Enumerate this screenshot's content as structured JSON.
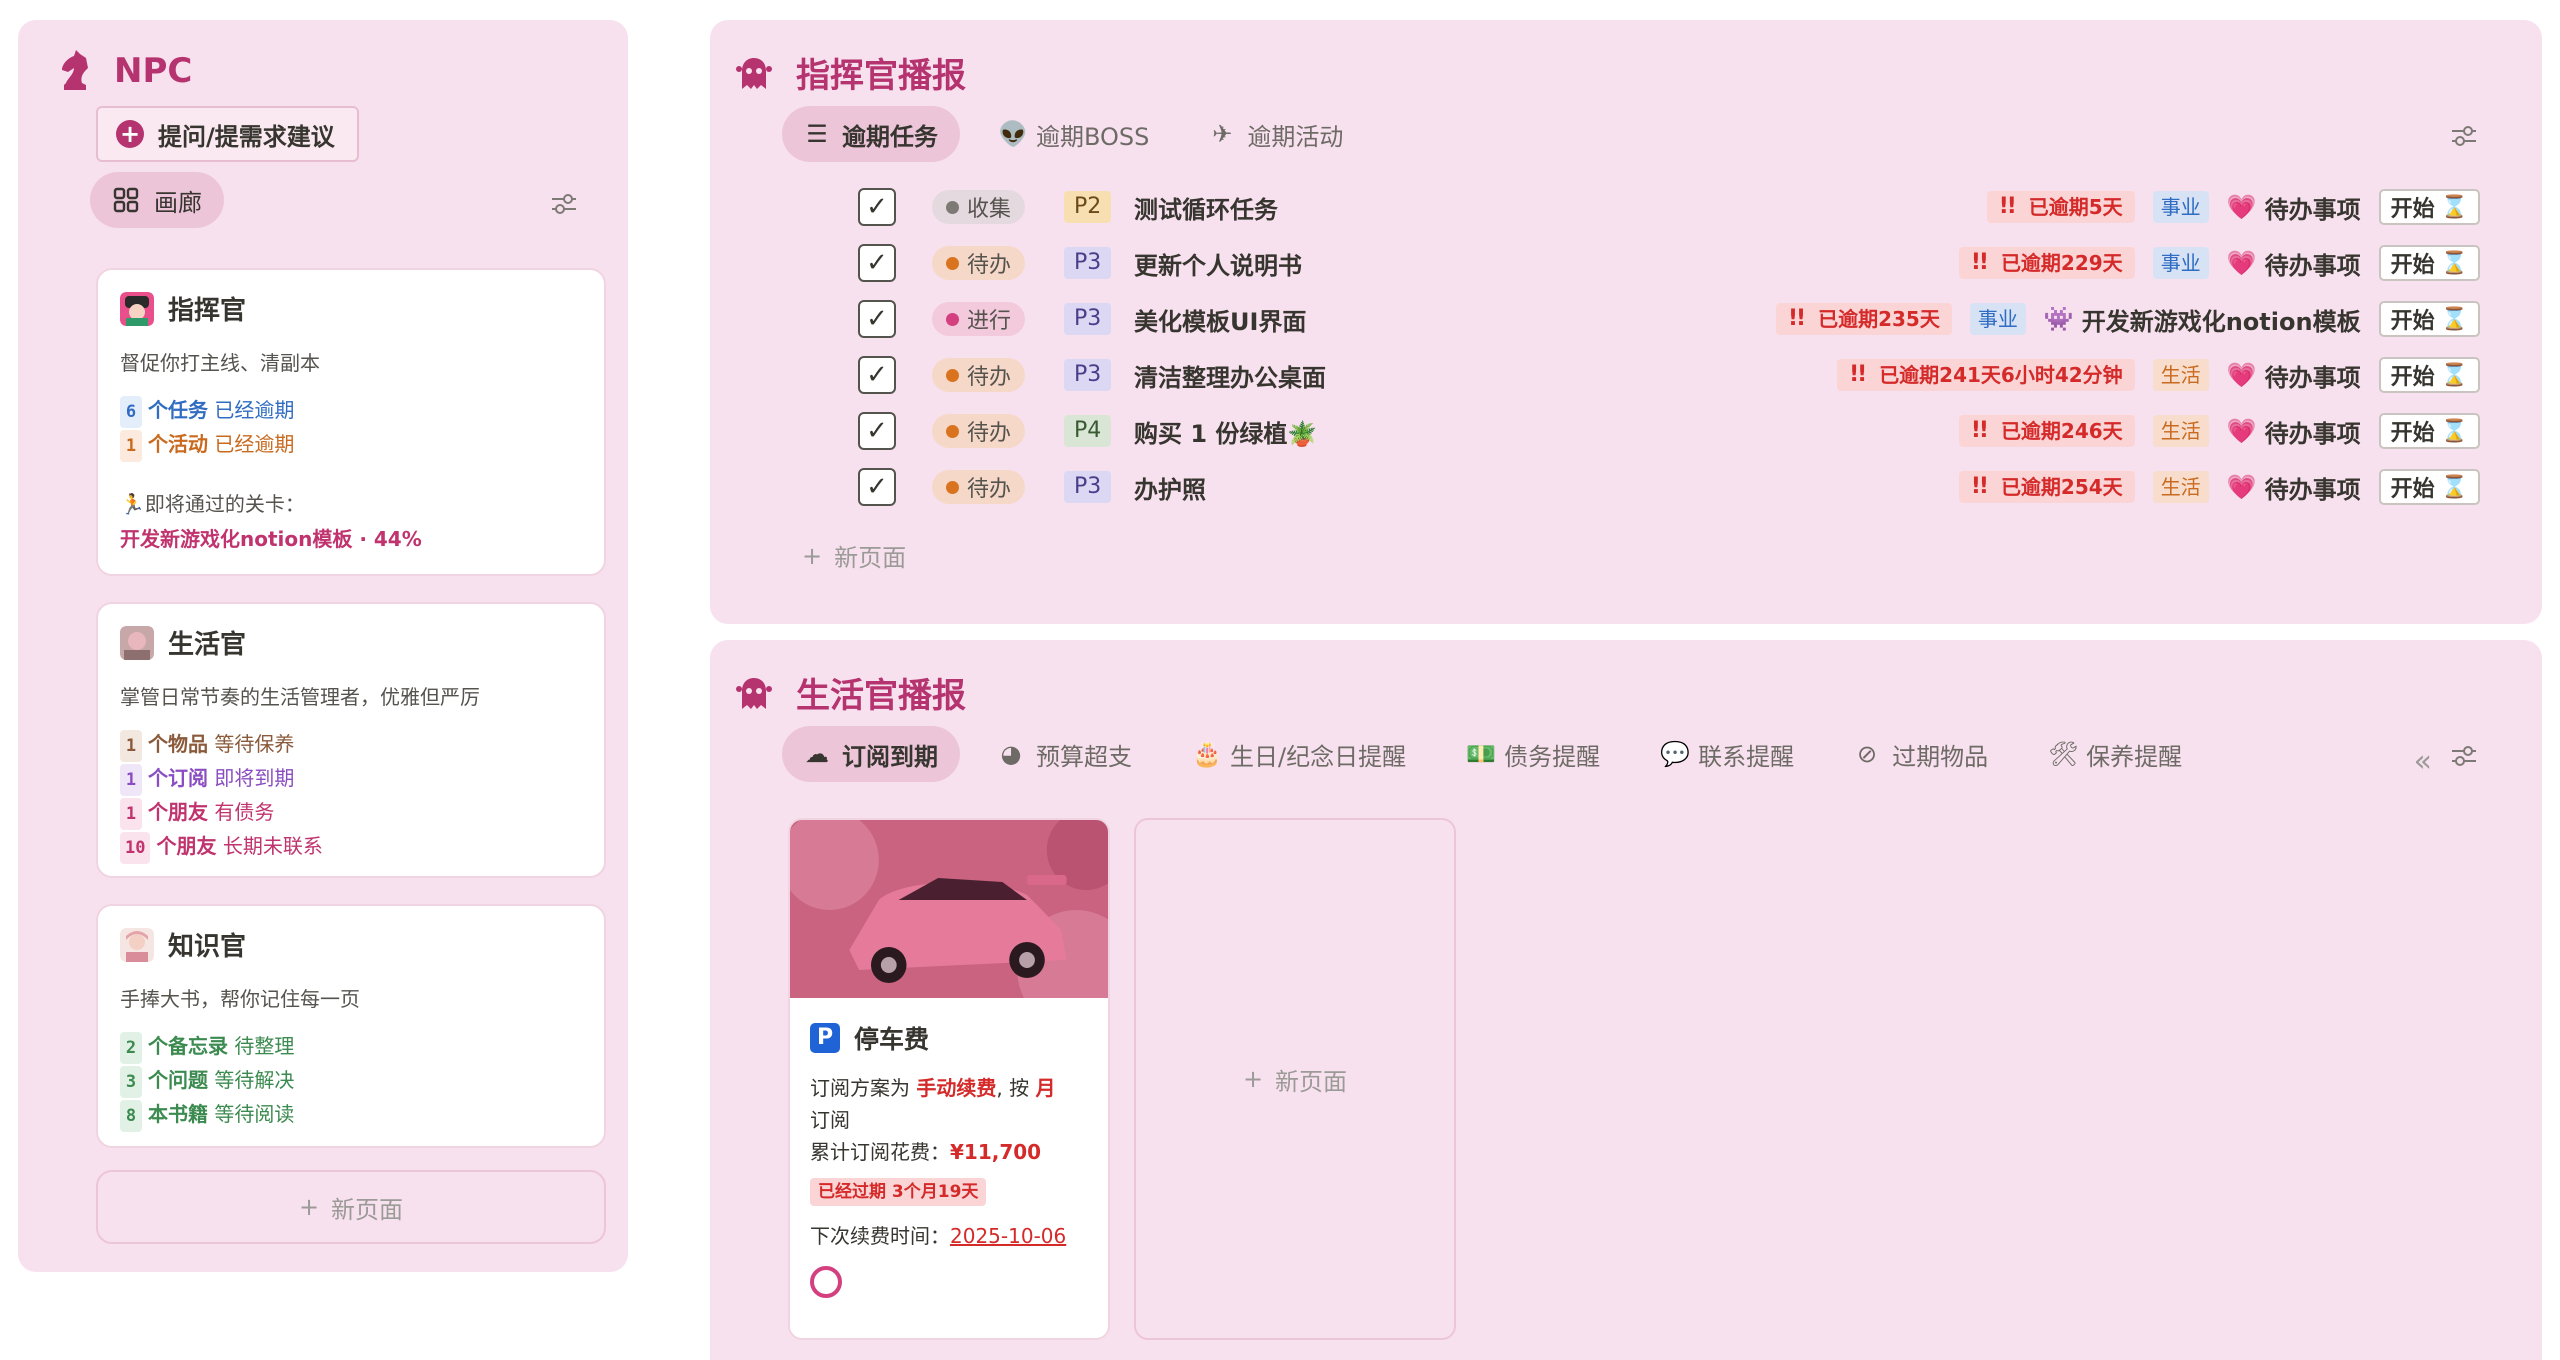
{
  "npc": {
    "title": "NPC",
    "ask_button": "提问/提需求建议",
    "gallery_tab": "画廊",
    "cards": [
      {
        "name": "指挥官",
        "desc": "督促你打主线、清副本",
        "stats": [
          {
            "num": "6",
            "noun": "个任务",
            "state": "已经逾期",
            "color": "blue"
          },
          {
            "num": "1",
            "noun": "个活动",
            "state": "已经逾期",
            "color": "orange"
          }
        ],
        "soon_label": "🏃即将通过的关卡：",
        "soon_link": "开发新游戏化notion模板 · 44%"
      },
      {
        "name": "生活官",
        "desc": "掌管日常节奏的生活管理者，优雅但严厉",
        "stats": [
          {
            "num": "1",
            "noun": "个物品",
            "state": "等待保养",
            "color": "brown"
          },
          {
            "num": "1",
            "noun": "个订阅",
            "state": "即将到期",
            "color": "purple"
          },
          {
            "num": "1",
            "noun": "个朋友",
            "state": "有债务",
            "color": "pink"
          },
          {
            "num": "10",
            "noun": "个朋友",
            "state": "长期未联系",
            "color": "pink"
          }
        ]
      },
      {
        "name": "知识官",
        "desc": "手捧大书，帮你记住每一页",
        "stats": [
          {
            "num": "2",
            "noun": "个备忘录",
            "state": "待整理",
            "color": "green"
          },
          {
            "num": "3",
            "noun": "个问题",
            "state": "等待解决",
            "color": "green"
          },
          {
            "num": "8",
            "noun": "本书籍",
            "state": "等待阅读",
            "color": "green"
          }
        ]
      }
    ],
    "new_page": "新页面"
  },
  "commander": {
    "title": "指挥官播报",
    "tabs": [
      "逾期任务",
      "逾期BOSS",
      "逾期活动"
    ],
    "rows": [
      {
        "status": "收集",
        "status_color": "gray",
        "priority": "P2",
        "task": "测试循环任务",
        "overdue": "已逾期5天",
        "category": "事业",
        "category_type": "work",
        "project_icon": "💗",
        "project": "待办事项",
        "start": "开始"
      },
      {
        "status": "待办",
        "status_color": "orange",
        "priority": "P3",
        "task": "更新个人说明书",
        "overdue": "已逾期229天",
        "category": "事业",
        "category_type": "work",
        "project_icon": "💗",
        "project": "待办事项",
        "start": "开始"
      },
      {
        "status": "进行",
        "status_color": "pink",
        "priority": "P3",
        "task": "美化模板UI界面",
        "overdue": "已逾期235天",
        "category": "事业",
        "category_type": "work",
        "project_icon": "👾",
        "project": "开发新游戏化notion模板",
        "start": "开始"
      },
      {
        "status": "待办",
        "status_color": "orange",
        "priority": "P3",
        "task": "清洁整理办公桌面",
        "overdue": "已逾期241天6小时42分钟",
        "category": "生活",
        "category_type": "life",
        "project_icon": "💗",
        "project": "待办事项",
        "start": "开始"
      },
      {
        "status": "待办",
        "status_color": "orange",
        "priority": "P4",
        "task": "购买 1 份绿植🪴",
        "overdue": "已逾期246天",
        "category": "生活",
        "category_type": "life",
        "project_icon": "💗",
        "project": "待办事项",
        "start": "开始"
      },
      {
        "status": "待办",
        "status_color": "orange",
        "priority": "P3",
        "task": "办护照",
        "overdue": "已逾期254天",
        "category": "生活",
        "category_type": "life",
        "project_icon": "💗",
        "project": "待办事项",
        "start": "开始"
      }
    ],
    "new_page": "新页面"
  },
  "life": {
    "title": "生活官播报",
    "tabs": [
      "订阅到期",
      "预算超支",
      "生日/纪念日提醒",
      "债务提醒",
      "联系提醒",
      "过期物品",
      "保养提醒"
    ],
    "card": {
      "title": "停车费",
      "plan_prefix": "订阅方案为",
      "plan_mode": "手动续费",
      "plan_mid": ", 按",
      "plan_period": "月",
      "plan_suffix": "订阅",
      "total_label": "累计订阅花费：",
      "total_value": "¥11,700",
      "expired": "已经过期  3个月19天",
      "next_label": "下次续费时间：",
      "next_date": "2025-10-06"
    },
    "new_page": "新页面"
  },
  "colors": {
    "panel_bg": "#f8e1ee",
    "accent": "#b5336f",
    "overdue_red": "#d42a2a"
  }
}
